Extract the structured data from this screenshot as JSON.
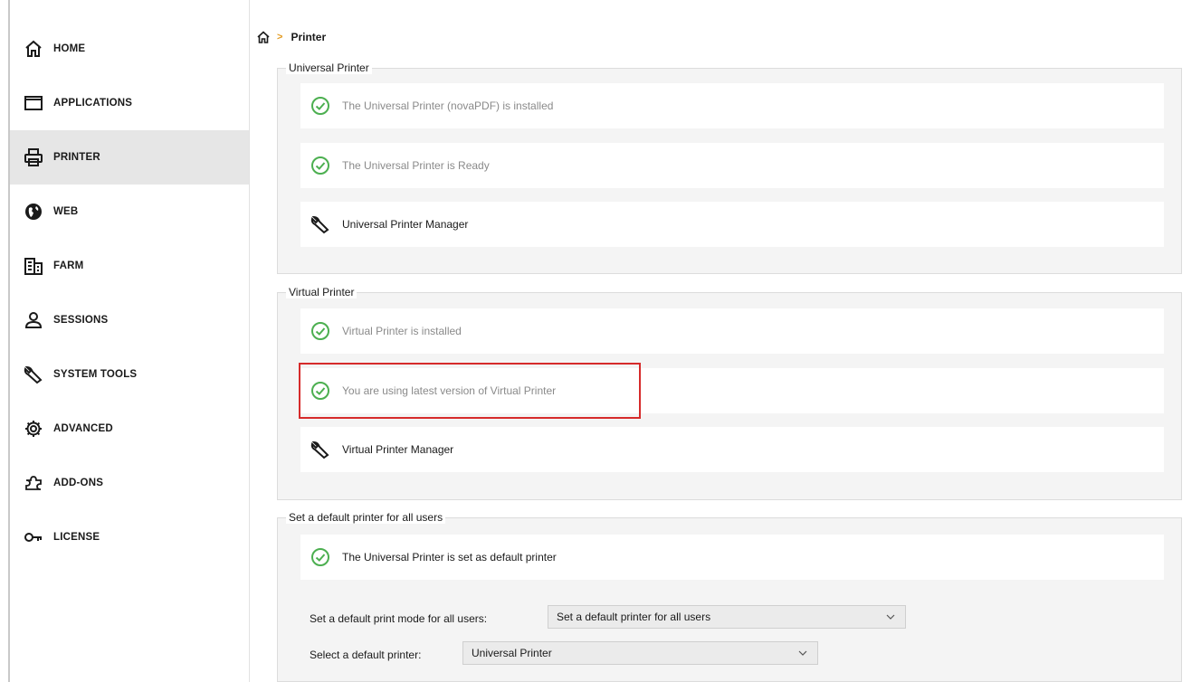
{
  "sidebar": {
    "items": [
      {
        "label": "HOME",
        "icon": "home-icon"
      },
      {
        "label": "APPLICATIONS",
        "icon": "window-icon"
      },
      {
        "label": "PRINTER",
        "icon": "printer-icon",
        "active": true
      },
      {
        "label": "WEB",
        "icon": "globe-icon"
      },
      {
        "label": "FARM",
        "icon": "building-icon"
      },
      {
        "label": "SESSIONS",
        "icon": "user-icon"
      },
      {
        "label": "SYSTEM TOOLS",
        "icon": "wrench-icon"
      },
      {
        "label": "ADVANCED",
        "icon": "gear-icon"
      },
      {
        "label": "ADD-ONS",
        "icon": "puzzle-icon"
      },
      {
        "label": "LICENSE",
        "icon": "key-icon"
      }
    ]
  },
  "breadcrumb": {
    "current": "Printer",
    "separator": ">"
  },
  "universal_printer": {
    "title": "Universal Printer",
    "status_installed": "The Universal Printer (novaPDF) is installed",
    "status_ready": "The Universal Printer is Ready",
    "manager_label": "Universal Printer Manager"
  },
  "virtual_printer": {
    "title": "Virtual Printer",
    "status_installed": "Virtual Printer is installed",
    "status_latest": "You are using latest version of Virtual Printer",
    "manager_label": "Virtual Printer Manager"
  },
  "default_printer": {
    "title": "Set a default printer for all users",
    "status": "The Universal Printer is set as default printer",
    "mode_label": "Set a default print mode for all users:",
    "mode_value": "Set a default printer for all users",
    "printer_label": "Select a default printer:",
    "printer_value": "Universal Printer"
  },
  "colors": {
    "check_green": "#4caf50",
    "accent_orange": "#e39b22",
    "highlight_red": "#d62b2b",
    "active_nav": "#e6e6e6"
  }
}
